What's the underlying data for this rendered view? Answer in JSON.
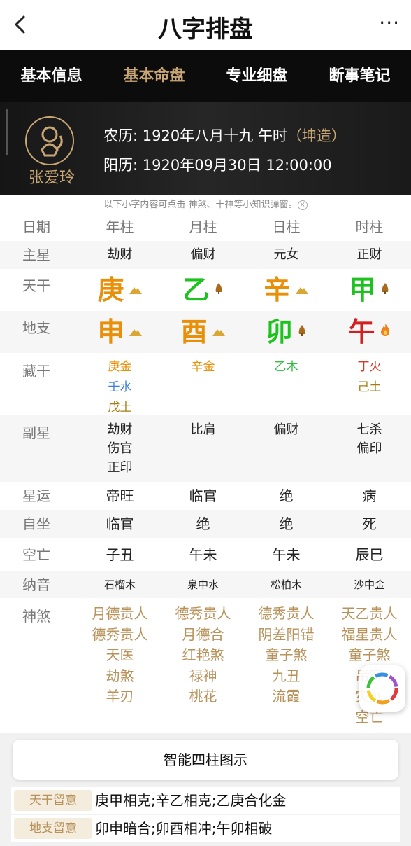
{
  "header": {
    "title": "八字排盘",
    "back_icon": "chevron-left-icon",
    "more_label": "···"
  },
  "tabs": [
    {
      "label": "基本信息",
      "active": false
    },
    {
      "label": "基本命盘",
      "active": true
    },
    {
      "label": "专业细盘",
      "active": false
    },
    {
      "label": "断事笔记",
      "active": false
    }
  ],
  "profile": {
    "name": "张爱玲",
    "lunar_prefix": "农历: ",
    "lunar_date": "1920年八月十九 午时",
    "gender_tag": "（坤造）",
    "solar_prefix": "阳历: ",
    "solar_date": "1920年09月30日 12:00:00"
  },
  "hint": "以下小字内容可点击 神煞、十神等小知识弹窗。",
  "grid": {
    "labels": {
      "date": "日期",
      "main_star": "主星",
      "stem": "天干",
      "branch": "地支",
      "hidden": "藏干",
      "sub_star": "副星",
      "star_luck": "星运",
      "self_seat": "自坐",
      "void": "空亡",
      "nayin": "纳音",
      "shensha": "神煞"
    },
    "columns": [
      {
        "name": "年柱",
        "main_star": "劫财",
        "stem": "庚",
        "branch": "申",
        "hidden": [
          "庚金",
          "壬水",
          "戊土"
        ],
        "sub_star": [
          "劫财",
          "伤官",
          "正印"
        ],
        "star_luck": "帝旺",
        "self_seat": "临官",
        "void": "子丑",
        "nayin": "石榴木",
        "shensha": [
          "月德贵人",
          "德秀贵人",
          "天医",
          "劫煞",
          "羊刃"
        ]
      },
      {
        "name": "月柱",
        "main_star": "偏财",
        "stem": "乙",
        "branch": "酉",
        "hidden": [
          "辛金"
        ],
        "sub_star": [
          "比肩"
        ],
        "star_luck": "临官",
        "self_seat": "绝",
        "void": "午未",
        "nayin": "泉中水",
        "shensha": [
          "德秀贵人",
          "月德合",
          "红艳煞",
          "禄神",
          "桃花"
        ]
      },
      {
        "name": "日柱",
        "main_star": "元女",
        "stem": "辛",
        "branch": "卯",
        "hidden": [
          "乙木"
        ],
        "sub_star": [
          "偏财"
        ],
        "star_luck": "绝",
        "self_seat": "绝",
        "void": "午未",
        "nayin": "松柏木",
        "shensha": [
          "德秀贵人",
          "阴差阳错",
          "童子煞",
          "九丑",
          "流霞"
        ]
      },
      {
        "name": "时柱",
        "main_star": "正财",
        "stem": "甲",
        "branch": "午",
        "hidden": [
          "丁火",
          "己土"
        ],
        "sub_star": [
          "七杀",
          "偏印"
        ],
        "star_luck": "病",
        "self_seat": "死",
        "void": "辰巳",
        "nayin": "沙中金",
        "shensha": [
          "天乙贵人",
          "福星贵人",
          "童子煞",
          "吊客",
          "灾煞",
          "空亡"
        ]
      }
    ]
  },
  "chart_button": "智能四柱图示",
  "notes": [
    {
      "tag": "天干留意",
      "text": "庚甲相克;辛乙相克;乙庚合化金"
    },
    {
      "tag": "地支留意",
      "text": "卯申暗合;卯酉相冲;午卯相破"
    }
  ],
  "colors": {
    "gold": "#c9a774",
    "metal": "#e8900a",
    "wood": "#1ec21e",
    "fire": "#d02020",
    "water": "#3a7fe0",
    "earth": "#a67c12"
  }
}
